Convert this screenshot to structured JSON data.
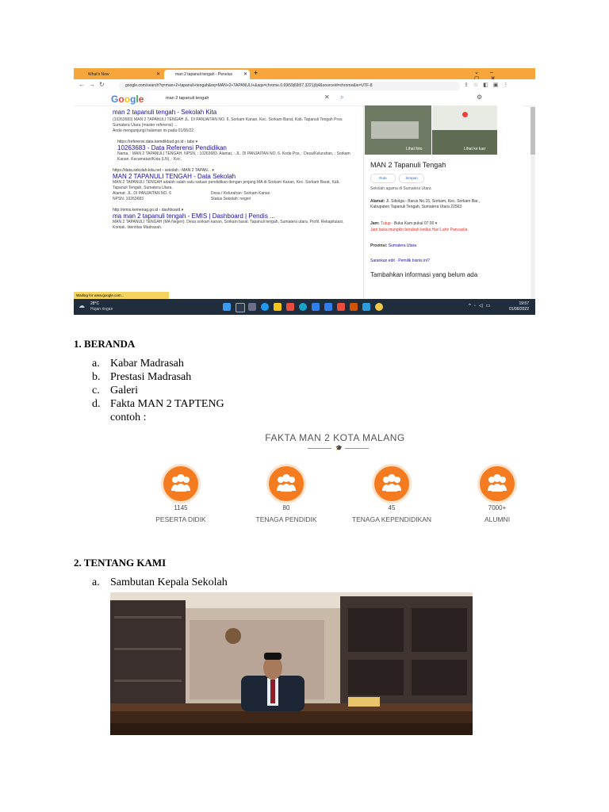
{
  "browser": {
    "tabs": [
      {
        "label": "What's New"
      },
      {
        "label": "man 2 tapanuli tengah - Penelus"
      }
    ],
    "url": "google.com/search?q=man+2+tapanuli+tengah&oq=MAN+2+TAPANULI+&aqs=chrome.0.69i59j69i57.3221j0j4&sourceid=chrome&ie=UTF-8",
    "search_query": "man 2 tapanuli tengah",
    "google_logo": "Google",
    "results": [
      {
        "title": "man 2 tapanuli tengah - Sekolah Kita",
        "text": "(10263683) MAN 2 TAPANULI TENGAH JL. DI PANJAITAN NO. 6, Sorkam Kanan, Kec. Sorkam Barat, Kab. Tapanuli Tengah Prov. Sumatera Utara (master referensi) ...",
        "visited": "Anda mengunjungi halaman ini pada 01/06/22."
      },
      {
        "cite": "https://referensi.data.kemdikbud.go.id › tabs ▾",
        "title": "10263683 - Data Referensi Pendidikan",
        "text": "Nama, : MAN 2 TAPANULI TENGAH. NPSN, : 10263683. Alamat, : JL. DI PANJAITAN NO. 6. Kode Pos, : Desa/Kelurahan, : Sorkam Kanan. Kecamatan/Kota (LN), : Kec."
      },
      {
        "cite": "https://data.sekolah-kita.net › sekolah › MAN 2 TAPAN... ▾",
        "title": "MAN 2 TAPANULI TENGAH - Data Sekolah",
        "text": "MAN 2 TAPANULI TENGAH adalah salah satu satuan pendidikan dengan jenjang MA di Sorkam Kanan, Kec. Sorkam Barat, Kab. Tapanuli Tengah, Sumatera Utara.",
        "alamat": "Alamat: JL. DI PANJAITAN NO. 6",
        "npsn": "NPSN: 10263683",
        "desa": "Desa / Kelurahan: Sorkam Kanan",
        "status": "Status Sekolah: negeri"
      },
      {
        "cite": "http://emis.kemenag.go.id › dashboard ▾",
        "title": "ma man 2 tapanuli tengah - EMIS | Dashboard | Pendis ...",
        "text": "MAN 2 TAPANULI TENGAH (MA Negeri). Desa sorkam kanan, Sorkam barat. Tapanuli tengah, Sumatera utara. Profil. Rekapitulasi. Kontak. Identitas Madrasah."
      }
    ],
    "knowledge_panel": {
      "photo_label": "Lihat foto",
      "outside_label": "Lihat ke luar",
      "name": "MAN 2 Tapanuli Tengah",
      "btn_route": "Rute",
      "btn_save": "Simpan",
      "category": "Sekolah agama di Sumatera Utara",
      "address_label": "Alamat:",
      "address": "Jl. Sibolga - Barus No.15, Sorkam, Kec. Sorkam Bar., Kabupaten Tapanuli Tengah, Sumatera Utara 22563",
      "hours_label": "Jam:",
      "hours_closed": "Tutup",
      "hours_open": " · Buka Kam pukul 07.00 ▾",
      "hours_note": "Jam buka mungkin berubah ketika Hari Lahir Pancasila",
      "province_label": "Provinsi:",
      "province": "Sumatera Utara",
      "suggest": "Sarankan edit · Pemilik bisnis ini?",
      "add_info": "Tambahkan informasi yang belum ada"
    },
    "status_text": "Waiting for www.google.com...",
    "weather_temp": "28°C",
    "weather_desc": "Hujan ringan",
    "clock_time": "19:57",
    "clock_date": "01/06/2022"
  },
  "doc": {
    "section1": "1. BERANDA",
    "items1": [
      {
        "marker": "a.",
        "text": "Kabar Madrasah"
      },
      {
        "marker": "b.",
        "text": "Prestasi Madrasah"
      },
      {
        "marker": "c.",
        "text": "Galeri"
      },
      {
        "marker": "d.",
        "text": "Fakta MAN 2 TAPTENG"
      }
    ],
    "contoh": "contoh :",
    "section2": "2. TENTANG KAMI",
    "items2": [
      {
        "marker": "a.",
        "text": "Sambutan Kepala Sekolah"
      }
    ]
  },
  "fakta": {
    "title": "FAKTA MAN 2 KOTA MALANG",
    "stats": [
      {
        "value": "1145",
        "label": "PESERTA DIDIK"
      },
      {
        "value": "80",
        "label": "TENAGA PENDIDIK"
      },
      {
        "value": "45",
        "label": "TENAGA KEPENDIDIKAN"
      },
      {
        "value": "7000+",
        "label": "ALUMNI"
      }
    ],
    "accent": "#f47b20"
  }
}
